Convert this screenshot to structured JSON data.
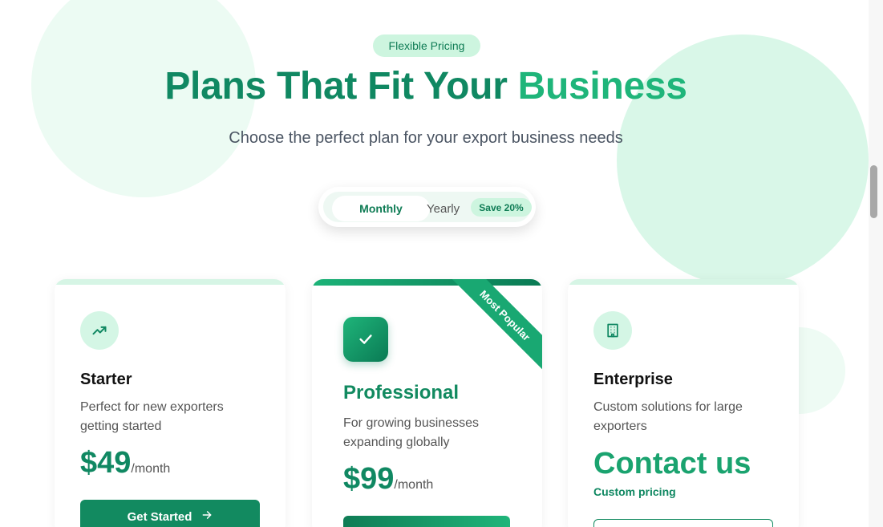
{
  "hero": {
    "badge": "Flexible Pricing",
    "title_part1": "Plans That Fit Your ",
    "title_part2": "Business",
    "subtitle": "Choose the perfect plan for your export business needs"
  },
  "billing_toggle": {
    "monthly_label": "Monthly",
    "yearly_label": "Yearly",
    "save_badge": "Save 20%",
    "selected": "Monthly"
  },
  "plans": [
    {
      "name": "Starter",
      "description": "Perfect for new exporters getting started",
      "price": "$49",
      "period": "/month",
      "button_label": "Get Started",
      "icon": "trending-up-icon"
    },
    {
      "name": "Professional",
      "description": "For growing businesses expanding globally",
      "price": "$99",
      "period": "/month",
      "ribbon": "Most Popular",
      "icon": "check-icon"
    },
    {
      "name": "Enterprise",
      "description": "Custom solutions for large exporters",
      "price": "Contact us",
      "price_note": "Custom pricing",
      "icon": "building-icon"
    }
  ],
  "colors": {
    "brand_dark": "#108862",
    "brand_light": "#1fb57a",
    "badge_bg": "#cdf5df"
  }
}
